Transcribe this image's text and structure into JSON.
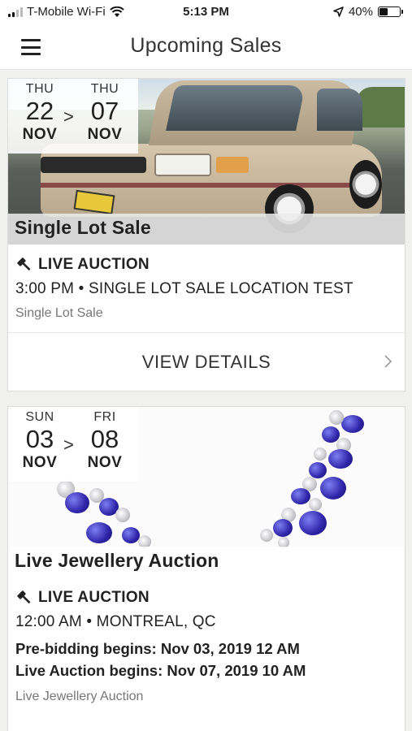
{
  "status_bar": {
    "carrier": "T-Mobile Wi-Fi",
    "time": "5:13 PM",
    "battery": "40%",
    "battery_level": 0.4
  },
  "header": {
    "title": "Upcoming Sales"
  },
  "sales": [
    {
      "start_dow": "THU",
      "start_day": "22",
      "start_mon": "NOV",
      "separator": ">",
      "end_dow": "THU",
      "end_day": "07",
      "end_mon": "NOV",
      "title": "Single Lot Sale",
      "type": "LIVE AUCTION",
      "time_location": "3:00 PM • SINGLE LOT SALE LOCATION TEST",
      "subtitle": "Single Lot Sale",
      "button": "VIEW DETAILS"
    },
    {
      "start_dow": "SUN",
      "start_day": "03",
      "start_mon": "NOV",
      "separator": ">",
      "end_dow": "FRI",
      "end_day": "08",
      "end_mon": "NOV",
      "title": "Live Jewellery Auction",
      "type": "LIVE AUCTION",
      "time_location": "12:00 AM • MONTREAL, QC",
      "pre_bidding": "Pre-bidding begins: Nov 03, 2019 12 AM",
      "live_begins": "Live Auction begins: Nov 07, 2019 10 AM",
      "subtitle": "Live Jewellery Auction"
    }
  ],
  "icons": {
    "menu": "hamburger-menu-icon",
    "wifi": "wifi-icon",
    "location": "location-arrow-icon",
    "battery": "battery-icon",
    "gavel": "gavel-icon",
    "chevron": "chevron-right-icon"
  }
}
